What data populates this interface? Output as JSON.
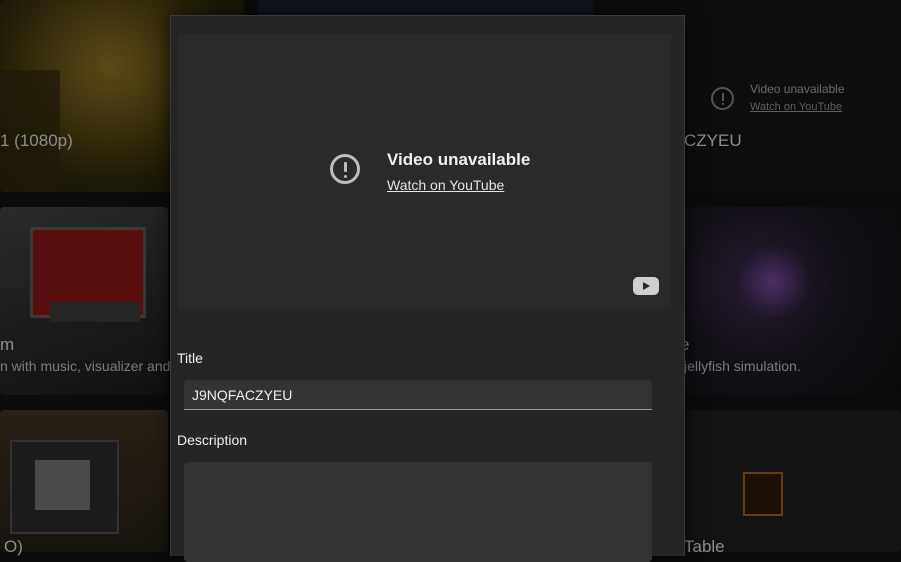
{
  "background": {
    "tiles": [
      {
        "title": "1 (1080p)",
        "description": ""
      },
      {
        "title": "CZYEU",
        "description": ""
      },
      {
        "title": "m",
        "description": "n with music, visualizer and"
      },
      {
        "title": "e",
        "description": "jellyfish simulation."
      },
      {
        "title": "O)",
        "description": ""
      },
      {
        "title": "Table",
        "description": ""
      }
    ],
    "mini_embed": {
      "title": "Video unavailable",
      "link": "Watch on YouTube"
    }
  },
  "modal": {
    "video": {
      "title": "Video unavailable",
      "link": "Watch on YouTube",
      "icon": "exclamation-circle-icon",
      "logo": "youtube-logo-icon"
    },
    "title_label": "Title",
    "title_value": "J9NQFACZYEU",
    "description_label": "Description",
    "description_value": ""
  },
  "colors": {
    "modal_bg": "#252525",
    "field_bg": "#333333",
    "page_bg": "#0b0b0b"
  }
}
